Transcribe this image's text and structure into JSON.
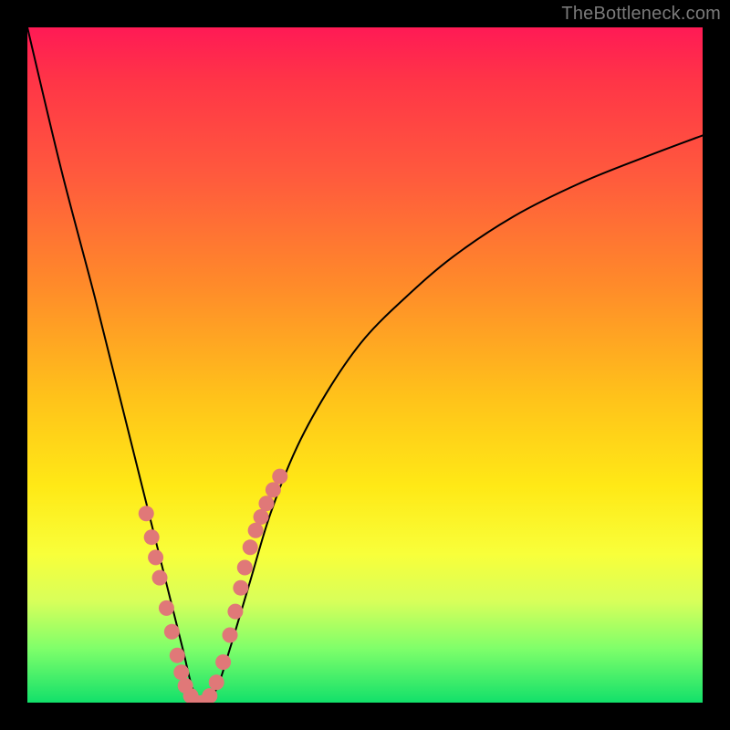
{
  "watermark": "TheBottleneck.com",
  "chart_data": {
    "type": "line",
    "title": "",
    "xlabel": "",
    "ylabel": "",
    "xlim": [
      0,
      100
    ],
    "ylim": [
      0,
      100
    ],
    "series": [
      {
        "name": "bottleneck-curve",
        "x": [
          0,
          5,
          10,
          14,
          17,
          19,
          21,
          23,
          24.5,
          26,
          28,
          30,
          33,
          36,
          40,
          45,
          50,
          56,
          63,
          72,
          82,
          92,
          100
        ],
        "y": [
          100,
          79,
          60,
          44,
          32,
          24,
          16,
          8,
          2,
          0,
          2,
          8,
          18,
          28,
          38,
          47,
          54,
          60,
          66,
          72,
          77,
          81,
          84
        ]
      }
    ],
    "markers": {
      "name": "sample-points",
      "color": "#e07878",
      "x": [
        17.6,
        18.4,
        19.0,
        19.6,
        20.6,
        21.4,
        22.2,
        22.8,
        23.4,
        24.2,
        25.0,
        26.0,
        27.0,
        28.0,
        29.0,
        30.0,
        30.8,
        31.6,
        32.2,
        33.0,
        33.8,
        34.6,
        35.4,
        36.4,
        37.4
      ],
      "y": [
        28.0,
        24.5,
        21.5,
        18.5,
        14.0,
        10.5,
        7.0,
        4.5,
        2.5,
        1.0,
        0.0,
        0.0,
        1.0,
        3.0,
        6.0,
        10.0,
        13.5,
        17.0,
        20.0,
        23.0,
        25.5,
        27.5,
        29.5,
        31.5,
        33.5
      ]
    }
  }
}
